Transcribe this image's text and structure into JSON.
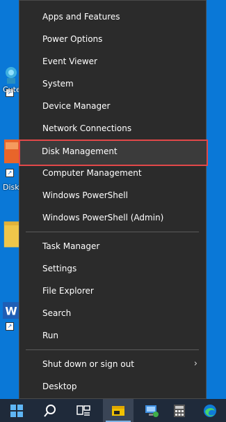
{
  "desktop": {
    "icons": [
      {
        "label": "Cute"
      },
      {
        "label": "Disk"
      },
      {
        "label": ""
      },
      {
        "label": ""
      }
    ]
  },
  "menu": {
    "items": [
      {
        "label": "Apps and Features"
      },
      {
        "label": "Power Options"
      },
      {
        "label": "Event Viewer"
      },
      {
        "label": "System"
      },
      {
        "label": "Device Manager"
      },
      {
        "label": "Network Connections"
      },
      {
        "label": "Disk Management"
      },
      {
        "label": "Computer Management"
      },
      {
        "label": "Windows PowerShell"
      },
      {
        "label": "Windows PowerShell (Admin)"
      },
      {
        "label": "Task Manager"
      },
      {
        "label": "Settings"
      },
      {
        "label": "File Explorer"
      },
      {
        "label": "Search"
      },
      {
        "label": "Run"
      },
      {
        "label": "Shut down or sign out"
      },
      {
        "label": "Desktop"
      }
    ],
    "highlighted_item": "Disk Management",
    "highlight_color": "#e24849"
  },
  "taskbar": {
    "buttons": [
      {
        "icon": "windows-start-icon"
      },
      {
        "icon": "search-icon"
      },
      {
        "icon": "task-view-icon"
      },
      {
        "icon": "sticky-notes-icon"
      },
      {
        "icon": "network-computer-icon"
      },
      {
        "icon": "calculator-icon"
      },
      {
        "icon": "edge-browser-icon"
      }
    ]
  }
}
